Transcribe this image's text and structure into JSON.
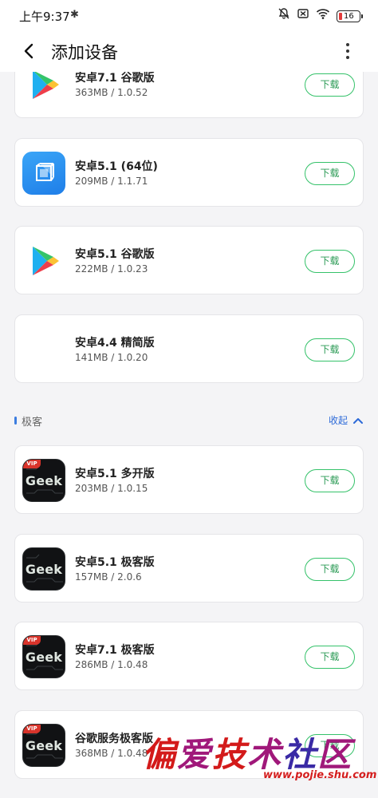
{
  "status_bar": {
    "time": "上午9:37",
    "battery": "16",
    "icons": [
      "bluetooth-icon",
      "bell-muted-icon",
      "sim-off-icon",
      "wifi-icon",
      "battery-icon"
    ]
  },
  "header": {
    "title": "添加设备",
    "icons": [
      "back-arrow-icon",
      "more-vertical-icon"
    ]
  },
  "cards": [
    {
      "name": "安卓7.1 谷歌版",
      "meta": "363MB / 1.0.52",
      "button": "下载",
      "icon": "google-play-icon"
    },
    {
      "name": "安卓5.1 (64位)",
      "meta": "209MB / 1.1.71",
      "button": "下载",
      "icon": "vmos-cube-icon"
    },
    {
      "name": "安卓5.1 谷歌版",
      "meta": "222MB / 1.0.23",
      "button": "下载",
      "icon": "google-play-icon"
    },
    {
      "name": "安卓4.4 精简版",
      "meta": "141MB / 1.0.20",
      "button": "下载",
      "icon": ""
    }
  ],
  "section": {
    "title": "极客",
    "collapse_label": "收起",
    "accent_color": "#3c7de0"
  },
  "geek_icon_text": {
    "word": "Geek",
    "vip": "VIP"
  },
  "geek_cards": [
    {
      "name": "安卓5.1 多开版",
      "meta": "203MB / 1.0.15",
      "button": "下载",
      "vip": true
    },
    {
      "name": "安卓5.1 极客版",
      "meta": "157MB / 2.0.6",
      "button": "下载",
      "vip": false
    },
    {
      "name": "安卓7.1 极客版",
      "meta": "286MB / 1.0.48",
      "button": "下载",
      "vip": true
    },
    {
      "name": "谷歌服务极客版",
      "meta": "368MB / 1.0.48",
      "button": "下载",
      "vip": true
    }
  ],
  "watermark": {
    "text": "偏爱技术社区",
    "url": "www.pojie.shu.com"
  },
  "colors": {
    "download_border": "#35c26a",
    "download_text": "#2a9a54",
    "link_blue": "#2d6ad8"
  }
}
